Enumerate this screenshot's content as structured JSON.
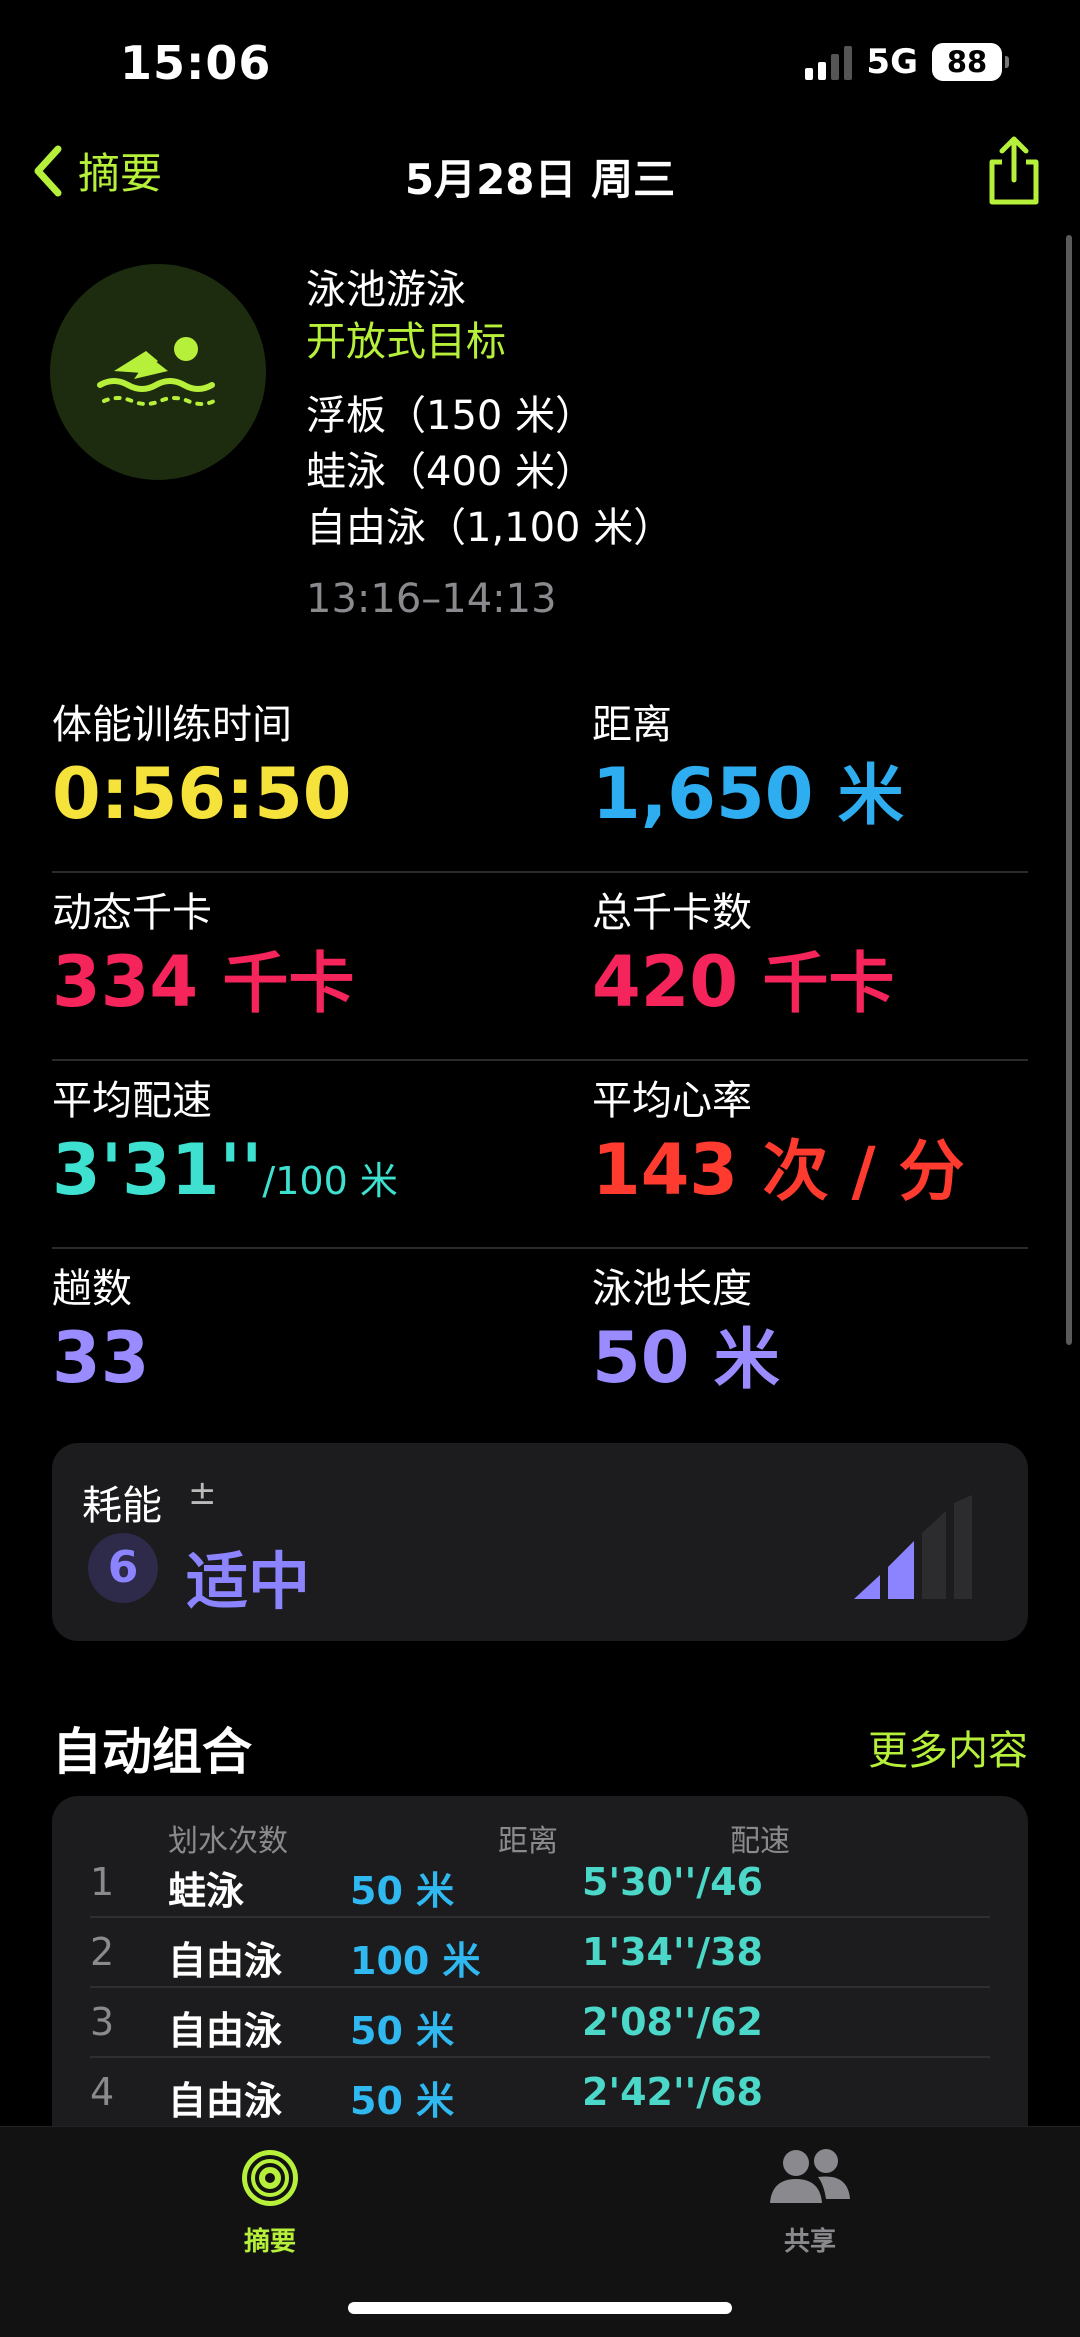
{
  "status_bar": {
    "time": "15:06",
    "network": "5G",
    "battery": "88"
  },
  "nav": {
    "back_label": "摘要",
    "title": "5月28日 周三"
  },
  "workout": {
    "type": "泳池游泳",
    "goal": "开放式目标",
    "segments": [
      "浮板（150 米）",
      "蛙泳（400 米）",
      "自由泳（1,100 米）"
    ],
    "time_range": "13:16–14:13"
  },
  "metrics": {
    "workout_time": {
      "label": "体能训练时间",
      "value": "0:56:50",
      "color": "#f5e23a"
    },
    "distance": {
      "label": "距离",
      "value": "1,650",
      "unit": "米",
      "color": "#2eaef0"
    },
    "active_kcal": {
      "label": "动态千卡",
      "value": "334",
      "unit": "千卡",
      "color": "#f5245a"
    },
    "total_kcal": {
      "label": "总千卡数",
      "value": "420",
      "unit": "千卡",
      "color": "#f5245a"
    },
    "avg_pace": {
      "label": "平均配速",
      "value": "3'31''",
      "unit": "/100 米",
      "color": "#3ee0d0"
    },
    "avg_hr": {
      "label": "平均心率",
      "value": "143",
      "unit": "次 / 分",
      "color": "#ff3b2f"
    },
    "laps": {
      "label": "趟数",
      "value": "33",
      "color": "#9a8cff"
    },
    "pool_length": {
      "label": "泳池长度",
      "value": "50",
      "unit": "米",
      "color": "#9a8cff"
    }
  },
  "effort": {
    "title": "耗能",
    "adjust_symbol": "±",
    "score": "6",
    "level": "适中",
    "bars_filled": 2,
    "bars_total": 4,
    "color": "#8c84ff"
  },
  "sets": {
    "title": "自动组合",
    "more": "更多内容",
    "headers": {
      "strokes": "划水次数",
      "distance": "距离",
      "pace": "配速"
    },
    "rows": [
      {
        "index": "1",
        "stroke": "蛙泳",
        "distance": "50 米",
        "pace": "5'30''/46"
      },
      {
        "index": "2",
        "stroke": "自由泳",
        "distance": "100 米",
        "pace": "1'34''/38"
      },
      {
        "index": "3",
        "stroke": "自由泳",
        "distance": "50 米",
        "pace": "2'08''/62"
      },
      {
        "index": "4",
        "stroke": "自由泳",
        "distance": "50 米",
        "pace": "2'42''/68"
      }
    ]
  },
  "tabs": [
    {
      "label": "摘要",
      "icon": "activity-rings-icon",
      "active": true
    },
    {
      "label": "共享",
      "icon": "people-icon",
      "active": false
    }
  ],
  "colors": {
    "accent": "#b6f03a"
  }
}
